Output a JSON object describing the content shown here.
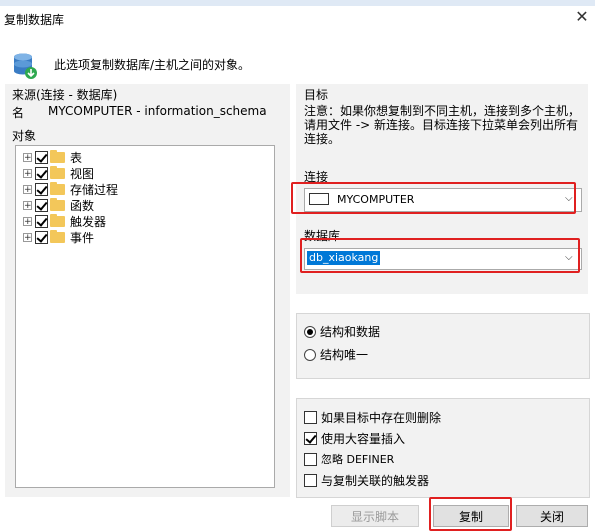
{
  "window": {
    "title": "复制数据库",
    "close": "✕"
  },
  "header": {
    "text": "此选项复制数据库/主机之间的对象。",
    "icon": "database-copy-icon"
  },
  "source": {
    "heading": "来源(连接 - 数据库)",
    "name_label": "名",
    "name_value": "MYCOMPUTER - information_schema",
    "objects_label": "对象",
    "tree": [
      {
        "label": "表",
        "checked": true
      },
      {
        "label": "视图",
        "checked": true
      },
      {
        "label": "存储过程",
        "checked": true
      },
      {
        "label": "函数",
        "checked": true
      },
      {
        "label": "触发器",
        "checked": true
      },
      {
        "label": "事件",
        "checked": true
      }
    ]
  },
  "target": {
    "heading": "目标",
    "note": "注意：如果你想复制到不同主机，连接到多个主机，请用文件 -> 新连接。目标连接下拉菜单会列出所有连接。",
    "connection_label": "连接",
    "connection_value": "MYCOMPUTER",
    "database_label": "数据库",
    "database_value": "db_xiaokang"
  },
  "mode": {
    "options": [
      {
        "label": "结构和数据",
        "selected": true
      },
      {
        "label": "结构唯一",
        "selected": false
      }
    ]
  },
  "options": [
    {
      "label": "如果目标中存在则删除",
      "checked": false
    },
    {
      "label": "使用大容量插入",
      "checked": true
    },
    {
      "label": "忽略 DEFINER",
      "checked": false
    },
    {
      "label": "与复制关联的触发器",
      "checked": false
    }
  ],
  "buttons": {
    "export": "显示脚本",
    "copy": "复制",
    "close": "关闭"
  },
  "colors": {
    "highlight_red": "#e02020",
    "selection_blue": "#0078d7"
  }
}
